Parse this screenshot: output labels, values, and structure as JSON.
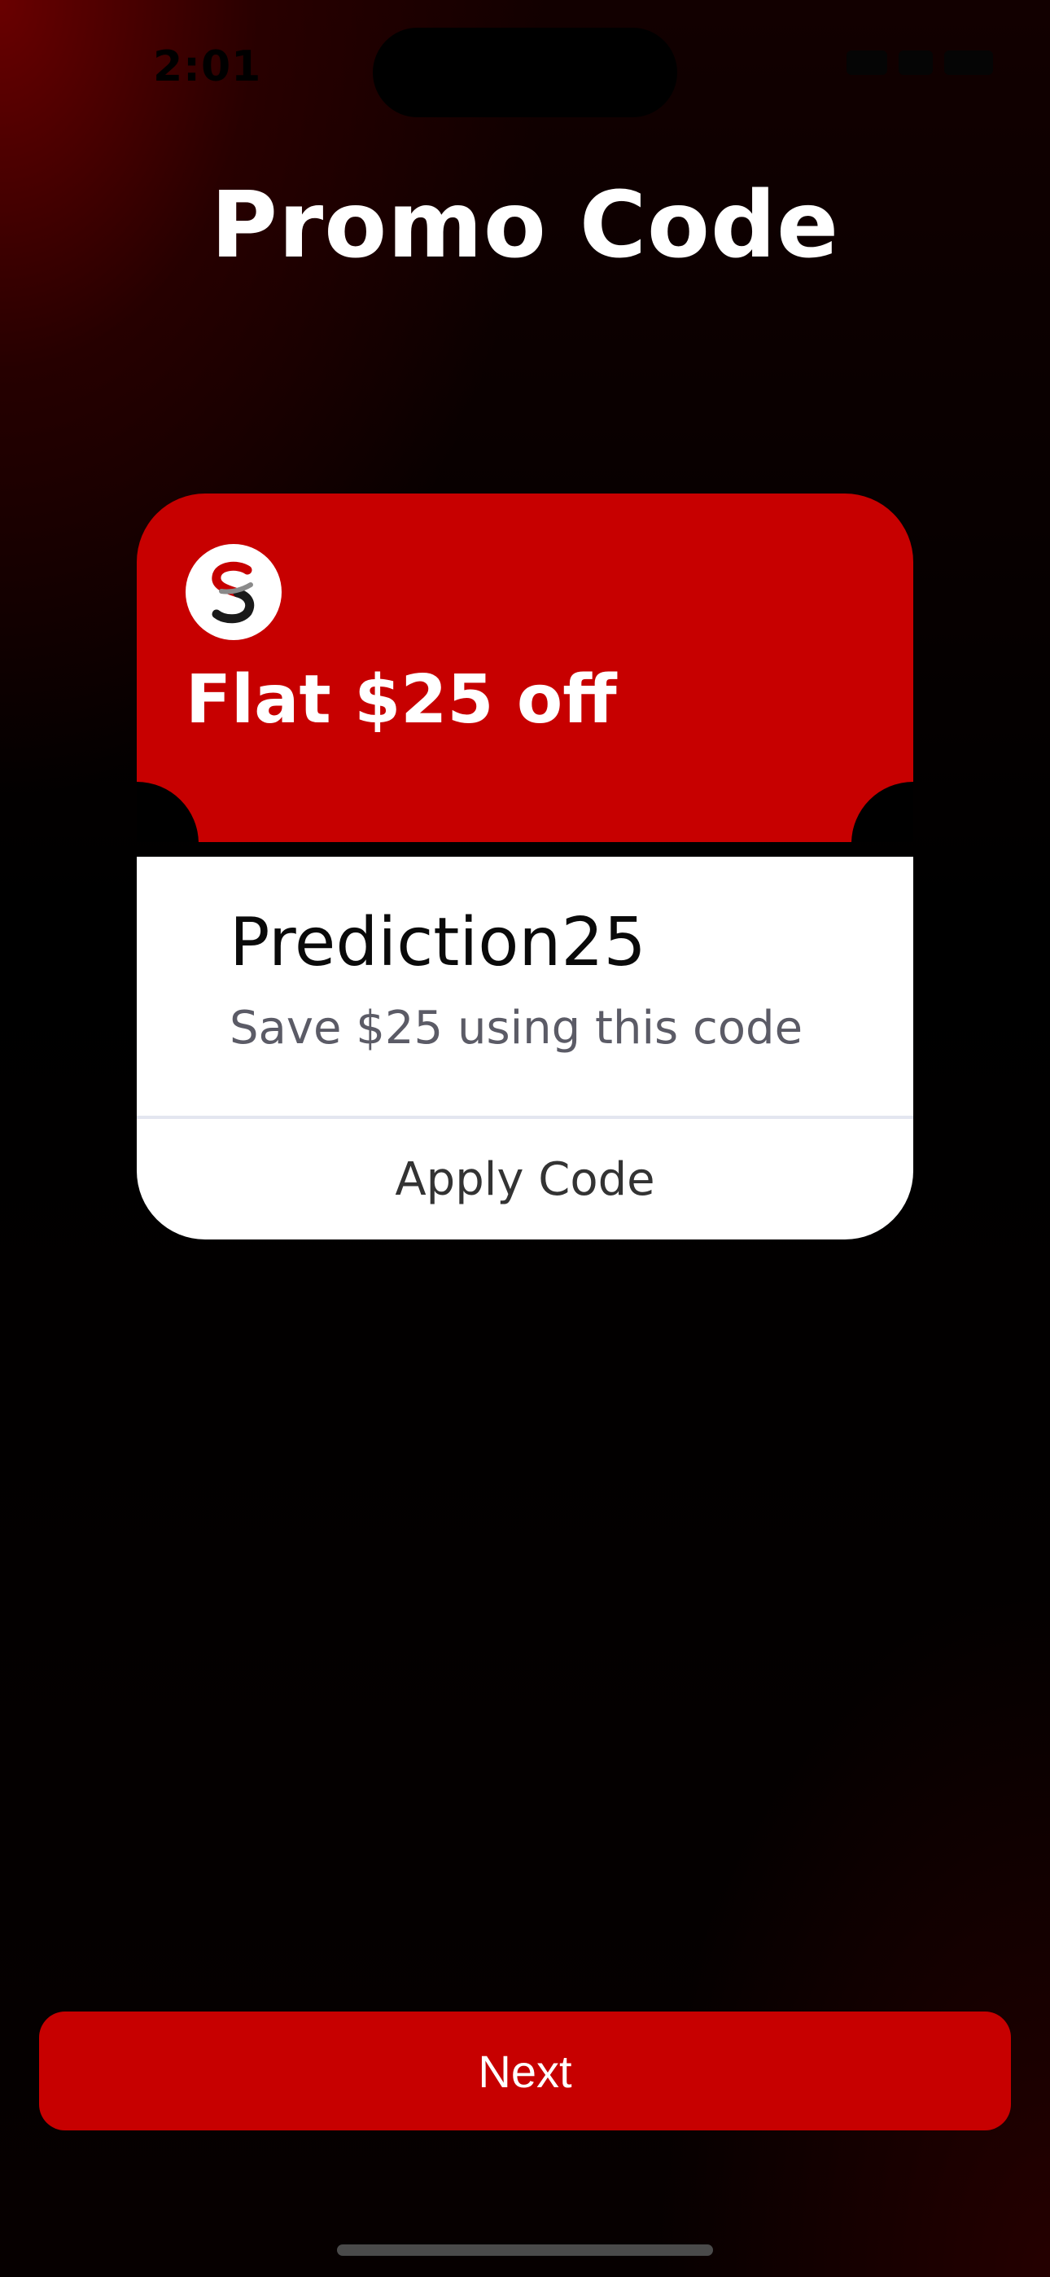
{
  "status_bar": {
    "time": "2:01"
  },
  "page": {
    "title": "Promo Code"
  },
  "coupon": {
    "logo_icon": "brand-s-logo-icon",
    "headline": "Flat $25 off",
    "code": "Prediction25",
    "description": "Save $25 using this code",
    "apply_label": "Apply Code"
  },
  "footer": {
    "next_label": "Next"
  },
  "colors": {
    "accent": "#c70000",
    "background": "#000000",
    "card_bottom": "#ffffff"
  }
}
